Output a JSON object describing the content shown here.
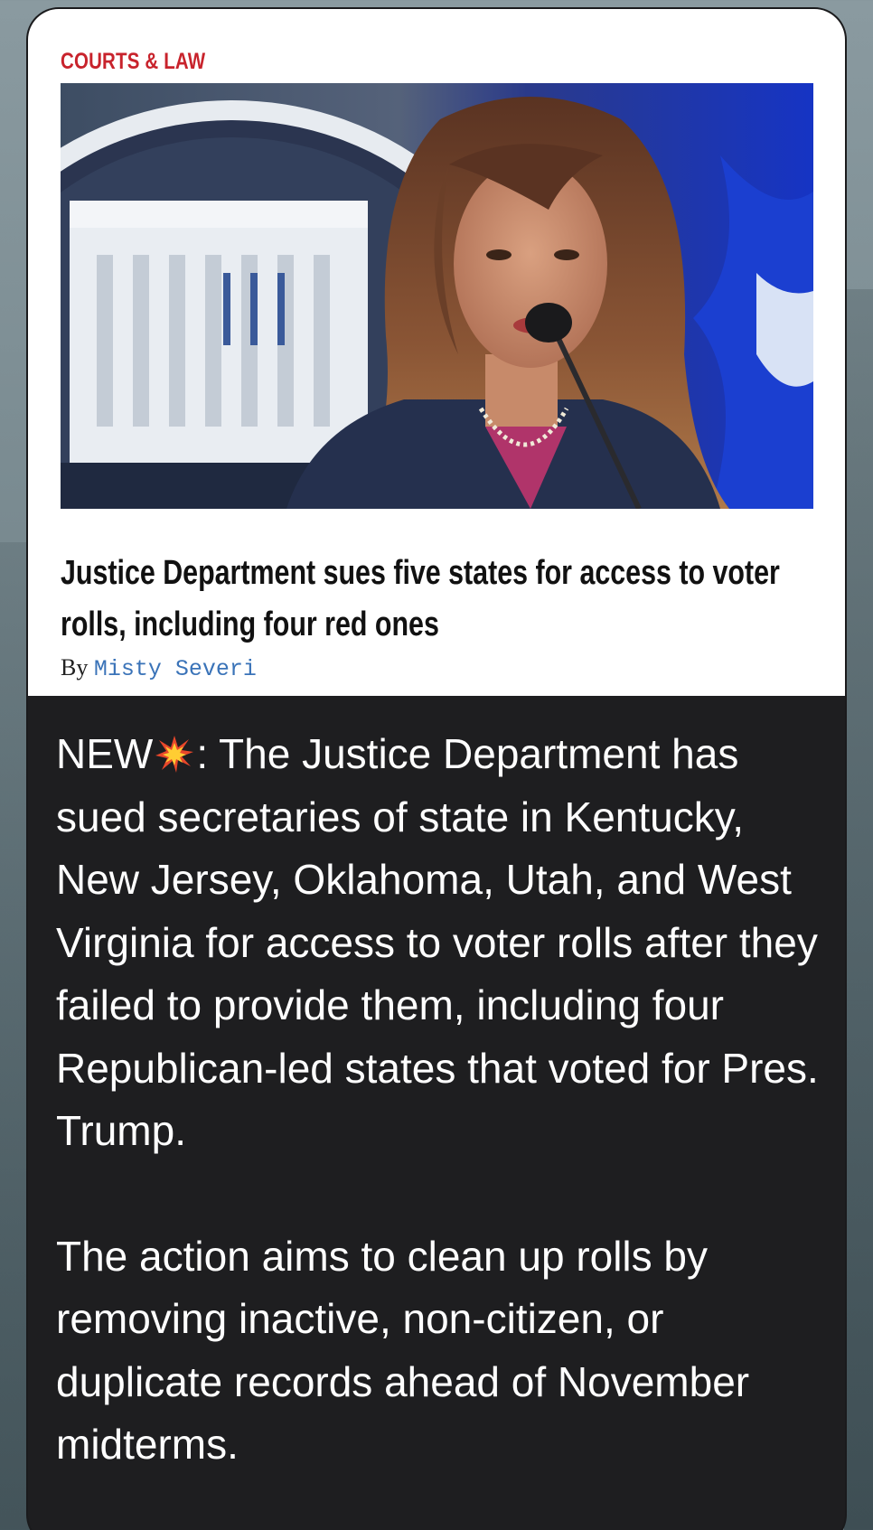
{
  "card": {
    "category": "COURTS & LAW",
    "headline": "Justice Department sues five states for access to voter rolls, including four red ones",
    "byline_prefix": "By",
    "author": "Misty Severi"
  },
  "message": {
    "new_label": "NEW",
    "emoji": "collision-emoji",
    "para1_rest": ": The Justice Department has sued secretaries of state in Kentucky, New Jersey, Oklahoma, Utah, and West Virginia for access to voter rolls after they failed to provide them, including four Republican-led states that voted for Pres. Trump.",
    "para2": "The action aims to clean up rolls by removing inactive, non-citizen, or duplicate records ahead of November midterms."
  },
  "colors": {
    "category_red": "#c8232c",
    "author_blue": "#3a73b8",
    "bubble_dark": "#1e1e20"
  }
}
